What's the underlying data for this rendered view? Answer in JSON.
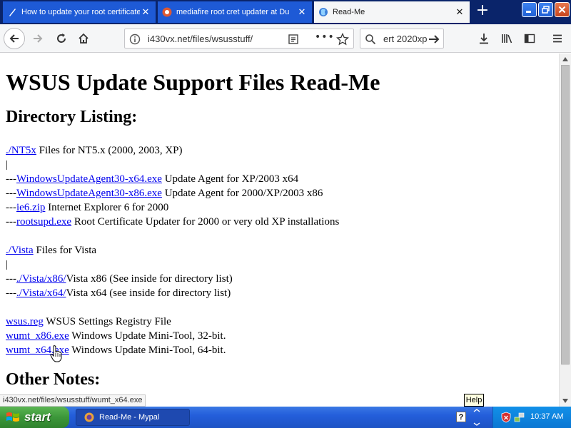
{
  "browser": {
    "tabs": [
      {
        "title": "How to update your root certificates",
        "favicon": "pen-icon"
      },
      {
        "title": "mediafire root cret updater at Du",
        "favicon": "shield-icon"
      },
      {
        "title": "Read-Me",
        "favicon": "globe-icon"
      }
    ],
    "new_tab_label": "+",
    "url": "i430vx.net/files/wsusstuff/",
    "search_text": "ert 2020xp",
    "page_actions_label": "•••"
  },
  "page": {
    "title": "WSUS Update Support Files Read-Me",
    "directory_heading": "Directory Listing:",
    "other_heading": "Other Notes:",
    "nt5x": {
      "link": "./NT5x",
      "desc": " Files for NT5.x (2000, 2003, XP)"
    },
    "pipe": "|",
    "prefix": "---",
    "nt5x_items": [
      {
        "link": "WindowsUpdateAgent30-x64.exe",
        "desc": " Update Agent for XP/2003 x64"
      },
      {
        "link": "WindowsUpdateAgent30-x86.exe",
        "desc": " Update Agent for 2000/XP/2003 x86"
      },
      {
        "link": "ie6.zip",
        "desc": " Internet Explorer 6 for 2000"
      },
      {
        "link": "rootsupd.exe",
        "desc": " Root Certificate Updater for 2000 or very old XP installations"
      }
    ],
    "vista": {
      "link": "./Vista",
      "desc": " Files for Vista"
    },
    "vista_items": [
      {
        "link": "./Vista/x86/",
        "desc": "Vista x86 (See inside for directory list)"
      },
      {
        "link": "./Vista/x64/",
        "desc": "Vista x64 (see inside for directory list)"
      }
    ],
    "misc_items": [
      {
        "link": "wsus.reg",
        "desc": " WSUS Settings Registry File"
      },
      {
        "link": "wumt_x86.exe",
        "desc": " Windows Update Mini-Tool, 32-bit."
      },
      {
        "link": "wumt_x64.exe",
        "desc": " Windows Update Mini-Tool, 64-bit."
      }
    ]
  },
  "status_url": "i430vx.net/files/wsusstuff/wumt_x64.exe",
  "tooltip": "Help",
  "taskbar": {
    "start_label": "start",
    "task_label": "Read-Me - Mypal",
    "lang": "?",
    "clock": "10:37 AM"
  }
}
